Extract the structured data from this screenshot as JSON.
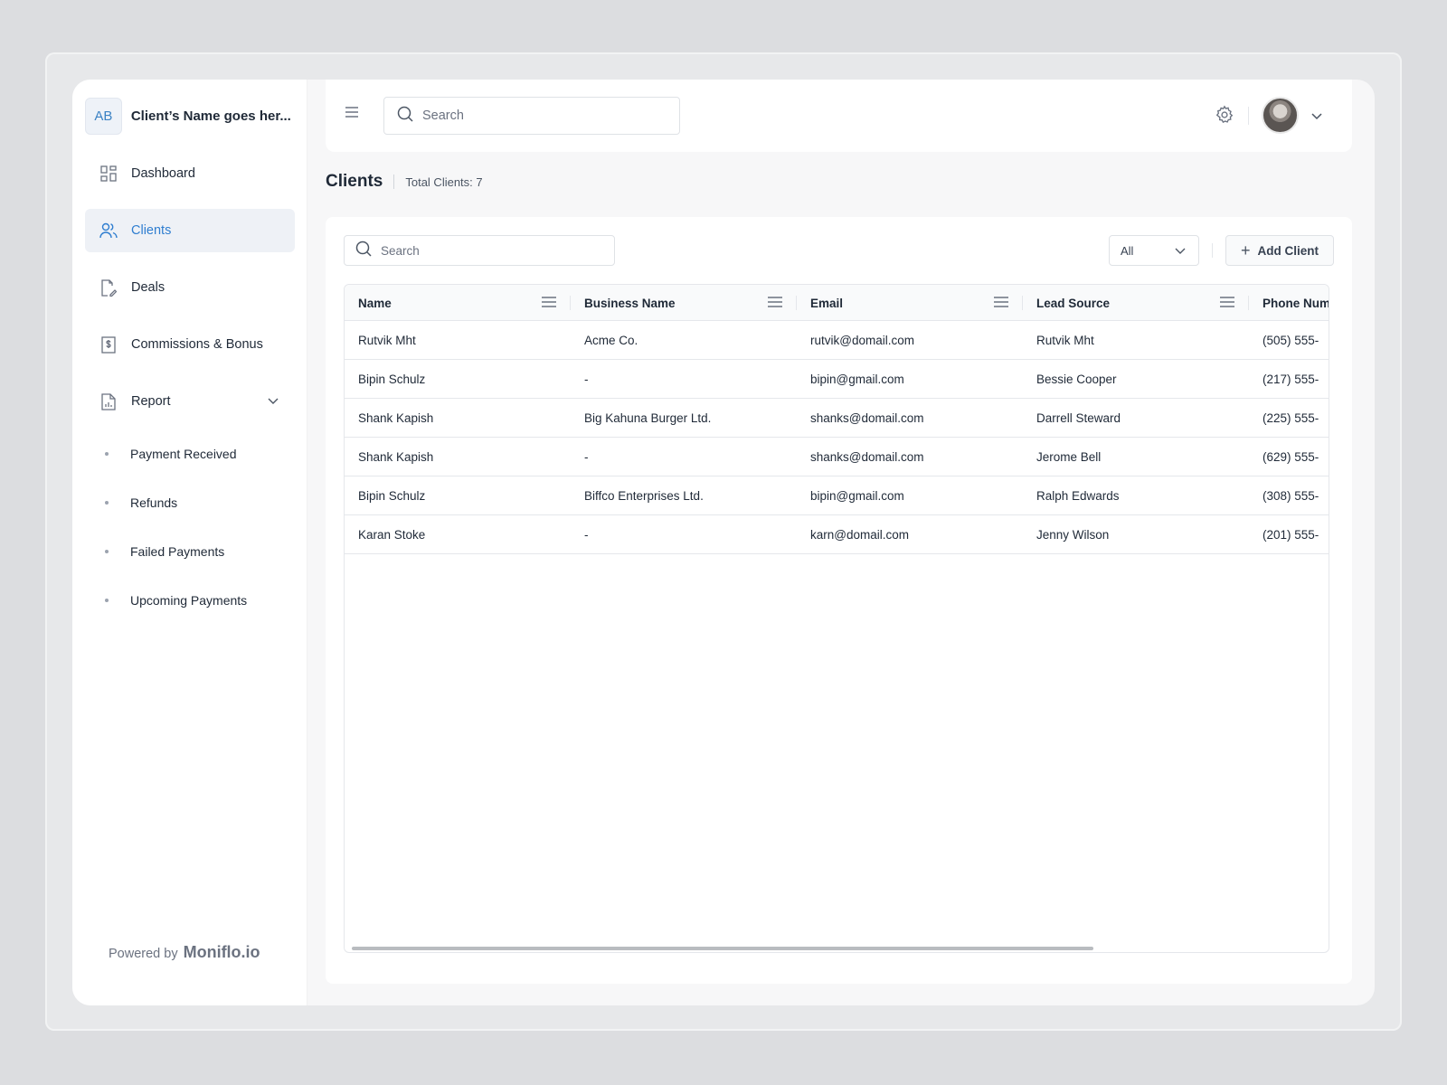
{
  "sidebar": {
    "org_initials": "AB",
    "org_name": "Client’s Name goes her...",
    "items": [
      {
        "label": "Dashboard"
      },
      {
        "label": "Clients"
      },
      {
        "label": "Deals"
      },
      {
        "label": "Commissions & Bonus"
      },
      {
        "label": "Report"
      }
    ],
    "report_sub": [
      {
        "label": "Payment Received"
      },
      {
        "label": "Refunds"
      },
      {
        "label": "Failed Payments"
      },
      {
        "label": "Upcoming Payments"
      }
    ],
    "powered_by": "Powered by",
    "brand": "Moniflo.io"
  },
  "header": {
    "search_placeholder": "Search"
  },
  "page": {
    "title": "Clients",
    "total": "Total Clients: 7"
  },
  "toolbar": {
    "search_placeholder": "Search",
    "filter_value": "All",
    "add_label": "Add Client"
  },
  "table": {
    "columns": [
      "Name",
      "Business Name",
      "Email",
      "Lead Source",
      "Phone Num"
    ],
    "rows": [
      [
        "Rutvik Mht",
        "Acme Co.",
        "rutvik@domail.com",
        "Rutvik Mht",
        "(505) 555-"
      ],
      [
        "Bipin Schulz",
        "-",
        "bipin@gmail.com",
        "Bessie Cooper",
        "(217) 555-"
      ],
      [
        "Shank Kapish",
        "Big Kahuna Burger Ltd.",
        "shanks@domail.com",
        "Darrell Steward",
        "(225) 555-"
      ],
      [
        "Shank Kapish",
        "-",
        "shanks@domail.com",
        "Jerome Bell",
        "(629) 555-"
      ],
      [
        "Bipin Schulz",
        "Biffco Enterprises Ltd.",
        "bipin@gmail.com",
        "Ralph Edwards",
        "(308) 555-"
      ],
      [
        "Karan Stoke",
        "-",
        "karn@domail.com",
        "Jenny Wilson",
        "(201) 555-"
      ]
    ]
  },
  "colors": {
    "accent": "#2f7ed0",
    "active_bg": "#eef1f6"
  }
}
